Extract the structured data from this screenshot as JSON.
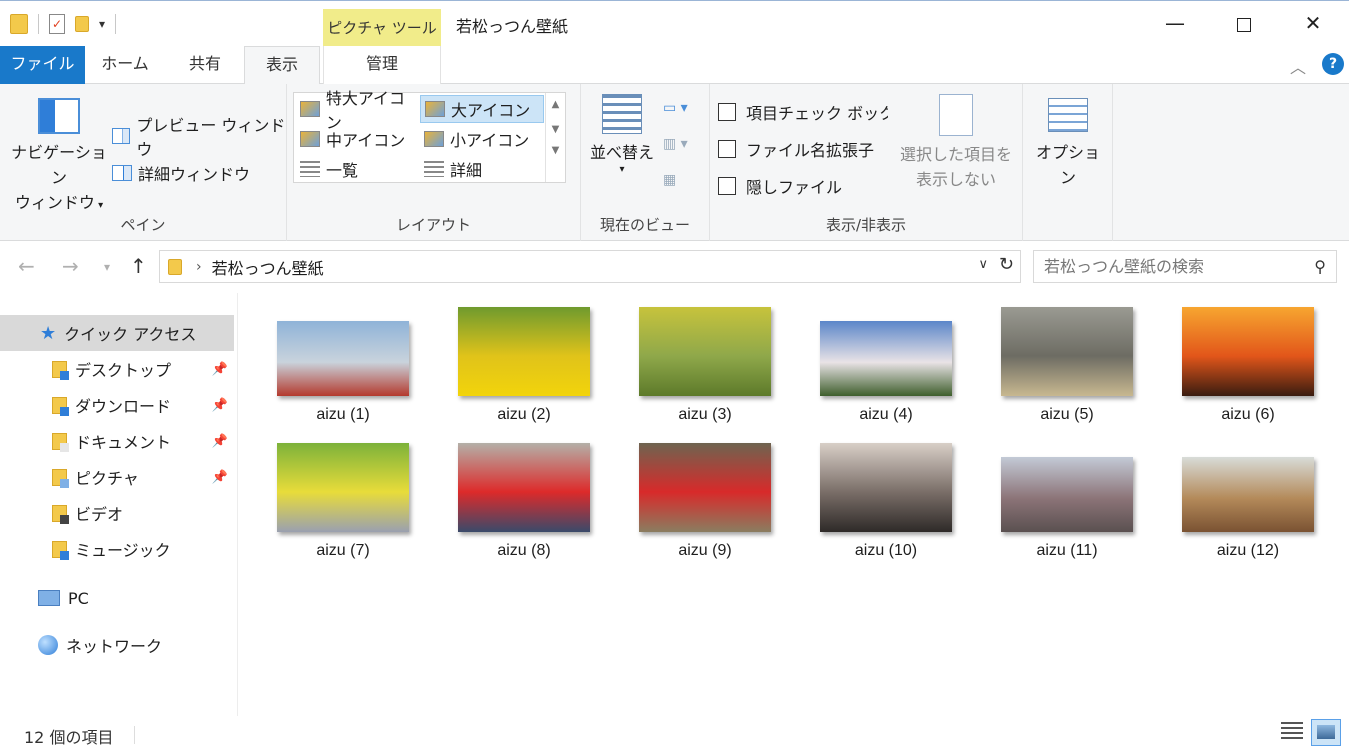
{
  "window": {
    "title": "若松っつん壁紙",
    "contextual_tab_header": "ピクチャ ツール"
  },
  "tabs": [
    {
      "label": "ファイル"
    },
    {
      "label": "ホーム"
    },
    {
      "label": "共有"
    },
    {
      "label": "表示"
    },
    {
      "label": "管理"
    }
  ],
  "ribbon": {
    "pane": {
      "label": "ペイン",
      "nav_pane_line1": "ナビゲーション",
      "nav_pane_line2": "ウィンドウ",
      "preview": "プレビュー ウィンドウ",
      "details": "詳細ウィンドウ"
    },
    "layout": {
      "label": "レイアウト",
      "items": [
        "特大アイコン",
        "大アイコン",
        "中アイコン",
        "小アイコン",
        "一覧",
        "詳細"
      ],
      "selected": "大アイコン"
    },
    "current_view": {
      "label": "現在のビュー",
      "sort": "並べ替え"
    },
    "show_hide": {
      "label": "表示/非表示",
      "item_checkboxes": "項目チェック ボックス",
      "extensions": "ファイル名拡張子",
      "hidden_items": "隠しファイル",
      "hide_selected_line1": "選択した項目を",
      "hide_selected_line2": "表示しない"
    },
    "options": {
      "label": "オプション"
    }
  },
  "address": {
    "path": "若松っつん壁紙",
    "search_placeholder": "若松っつん壁紙の検索"
  },
  "navpane": {
    "quick_access": "クイック アクセス",
    "items": [
      {
        "label": "デスクトップ",
        "pinned": true,
        "color": "#2f7ed8"
      },
      {
        "label": "ダウンロード",
        "pinned": true,
        "color": "#2f7ed8"
      },
      {
        "label": "ドキュメント",
        "pinned": true,
        "color": "#e6e6e6"
      },
      {
        "label": "ピクチャ",
        "pinned": true,
        "color": "#7fb0e6"
      },
      {
        "label": "ビデオ",
        "pinned": false,
        "color": "#444444"
      },
      {
        "label": "ミュージック",
        "pinned": false,
        "color": "#2f7ed8"
      }
    ],
    "pc": "PC",
    "network": "ネットワーク"
  },
  "files": [
    {
      "name": "aizu (1)",
      "colors": [
        "#8fb3d8",
        "#c9d3dc",
        "#b43a2e"
      ]
    },
    {
      "name": "aizu (2)",
      "colors": [
        "#6f9a2e",
        "#e0c31a",
        "#f2d40b"
      ]
    },
    {
      "name": "aizu (3)",
      "colors": [
        "#c7c33c",
        "#8fa84a",
        "#5d7a2a"
      ]
    },
    {
      "name": "aizu (4)",
      "colors": [
        "#5b86c9",
        "#e9e3e6",
        "#3f5f2d"
      ]
    },
    {
      "name": "aizu (5)",
      "colors": [
        "#9a9a92",
        "#6d6c63",
        "#c8b890"
      ]
    },
    {
      "name": "aizu (6)",
      "colors": [
        "#f7a630",
        "#e2561a",
        "#3a1c10"
      ]
    },
    {
      "name": "aizu (7)",
      "colors": [
        "#7db23a",
        "#e8dc3a",
        "#9aa0b0"
      ]
    },
    {
      "name": "aizu (8)",
      "colors": [
        "#b4b0a8",
        "#dd2a2a",
        "#3a4a6a"
      ]
    },
    {
      "name": "aizu (9)",
      "colors": [
        "#6e6450",
        "#d82a2a",
        "#8a7d60"
      ]
    },
    {
      "name": "aizu (10)",
      "colors": [
        "#d8cfc7",
        "#7a6e68",
        "#2e2a28"
      ]
    },
    {
      "name": "aizu (11)",
      "colors": [
        "#c3cad6",
        "#8c7478",
        "#5a5050"
      ]
    },
    {
      "name": "aizu (12)",
      "colors": [
        "#d8dcd8",
        "#b48a5a",
        "#7a5232"
      ]
    }
  ],
  "status": {
    "count": "12 個の項目"
  }
}
